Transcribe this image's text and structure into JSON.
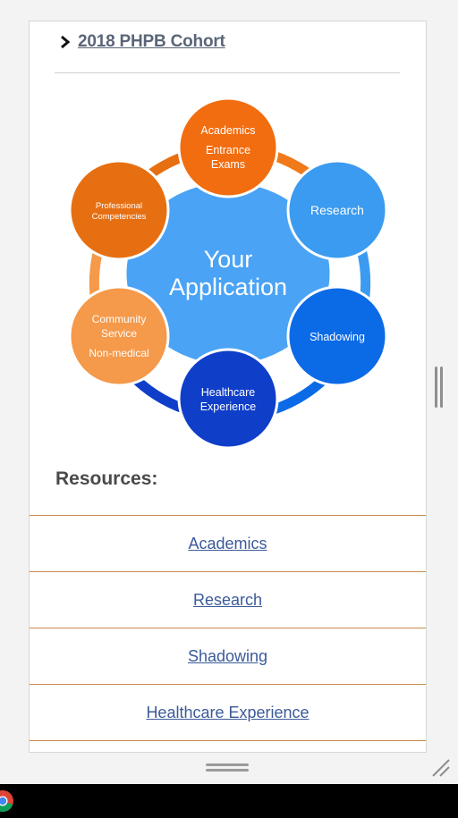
{
  "cohort": {
    "label": "2018 PHPB Cohort"
  },
  "diagram": {
    "center_line1": "Your",
    "center_line2": "Application",
    "nodes": {
      "academics": {
        "line1": "Academics",
        "line2": "Entrance",
        "line3": "Exams",
        "color": "#f26d0f"
      },
      "research": {
        "label": "Research",
        "color": "#3b9bf0"
      },
      "shadowing": {
        "label": "Shadowing",
        "color": "#0b6ae6"
      },
      "healthcare": {
        "line1": "Healthcare",
        "line2": "Experience",
        "color": "#0f3ec9"
      },
      "community": {
        "line1": "Community",
        "line2": "Service",
        "line3": "Non-medical",
        "color": "#f5994a"
      },
      "professional": {
        "line1": "Professional",
        "line2": "Competencies",
        "color": "#e66f12"
      }
    },
    "hub_color": "#4aa3f5"
  },
  "resources": {
    "heading": "Resources:",
    "links": [
      "Academics",
      "Research",
      "Shadowing",
      "Healthcare Experience"
    ]
  },
  "colors": {
    "link": "#3c5a99",
    "divider": "#c9894a"
  }
}
